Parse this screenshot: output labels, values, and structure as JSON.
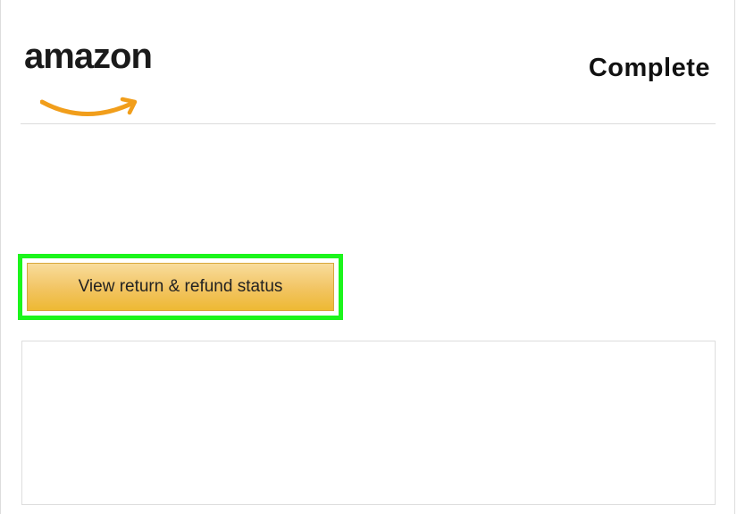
{
  "header": {
    "logo_text": "amazon",
    "status": "Complete"
  },
  "actions": {
    "refund_button_label": "View return & refund status"
  },
  "colors": {
    "highlight": "#1cf51c",
    "button_top": "#f8dc9c",
    "button_bottom": "#eeb933",
    "smile": "#f19e1b"
  }
}
